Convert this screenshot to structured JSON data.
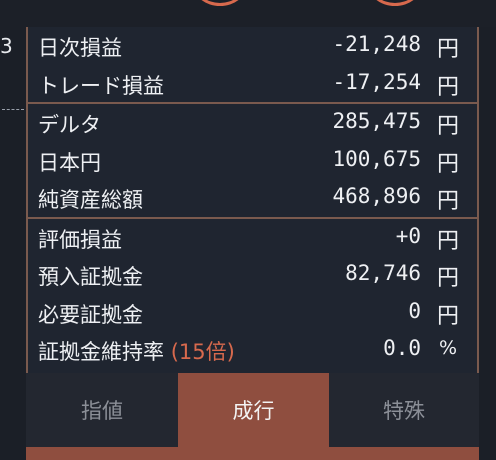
{
  "header": {
    "fragment_left": "",
    "fragment_right": ""
  },
  "side": {
    "digit": "3"
  },
  "account": {
    "group1": [
      {
        "label": "日次損益",
        "value": "-21,248",
        "unit": "円"
      },
      {
        "label": "トレード損益",
        "value": "-17,254",
        "unit": "円"
      }
    ],
    "group2": [
      {
        "label": "デルタ",
        "value": "285,475",
        "unit": "円"
      },
      {
        "label": "日本円",
        "value": "100,675",
        "unit": "円"
      },
      {
        "label": "純資産総額",
        "value": "468,896",
        "unit": "円"
      }
    ],
    "group3": [
      {
        "label": "評価損益",
        "value": "+0",
        "unit": "円"
      },
      {
        "label": "預入証拠金",
        "value": "82,746",
        "unit": "円"
      },
      {
        "label": "必要証拠金",
        "value": "0",
        "unit": "円"
      }
    ],
    "margin_ratio": {
      "label": "証拠金維持率",
      "leverage": "(15倍)",
      "value": "0.0",
      "unit": "%"
    }
  },
  "order_tabs": {
    "limit": "指値",
    "market": "成行",
    "special": "特殊",
    "selected": "market"
  },
  "colors": {
    "accent": "#d7694d",
    "active_tab": "#8f4e3f",
    "panel_bg": "#1f2530",
    "border": "#7a5a4e"
  }
}
